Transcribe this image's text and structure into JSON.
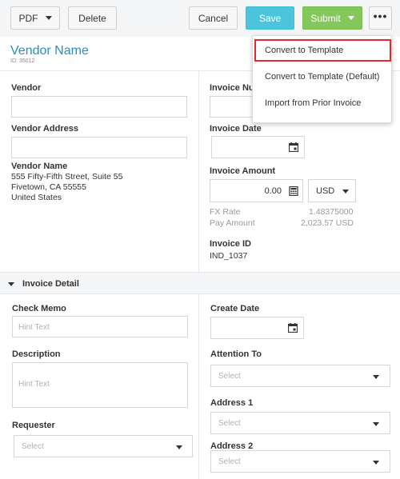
{
  "toolbar": {
    "pdf_label": "PDF",
    "delete_label": "Delete",
    "cancel_label": "Cancel",
    "save_label": "Save",
    "submit_label": "Submit",
    "more_label": "•••"
  },
  "header": {
    "title": "Vendor Name",
    "id_text": "ID: 35012"
  },
  "vendor": {
    "vendor_label": "Vendor",
    "vendor_value": "",
    "address_label": "Vendor Address",
    "address_value": "",
    "name_label": "Vendor Name",
    "address_lines": [
      "555 Fifty-Fifth Street, Suite 55",
      "Fivetown, CA 55555",
      "United States"
    ]
  },
  "invoice": {
    "number_label": "Invoice Nu",
    "date_label": "Invoice Date",
    "amount_label": "Invoice Amount",
    "amount_value": "0.00",
    "currency": "USD",
    "fx_rate_label": "FX Rate",
    "fx_rate_value": "1.48375000",
    "pay_amount_label": "Pay Amount",
    "pay_amount_value": "2,023.57 USD",
    "id_label": "Invoice ID",
    "id_value": "IND_1037"
  },
  "detail": {
    "section_title": "Invoice Detail",
    "check_memo_label": "Check Memo",
    "check_memo_placeholder": "Hint Text",
    "description_label": "Description",
    "description_placeholder": "Hint Text",
    "requester_label": "Requester",
    "requester_placeholder": "Select",
    "create_date_label": "Create Date",
    "attention_label": "Attention To",
    "attention_placeholder": "Select",
    "address1_label": "Address 1",
    "address1_placeholder": "Select",
    "address2_label": "Address 2",
    "address2_placeholder": "Select"
  },
  "menu": {
    "items": [
      "Convert to Template",
      "Convert to Template (Default)",
      "Import from Prior Invoice"
    ]
  },
  "colors": {
    "link": "#2a8cc4",
    "save": "#4cc4dc",
    "submit": "#84c75a",
    "highlight": "#e3282f"
  }
}
